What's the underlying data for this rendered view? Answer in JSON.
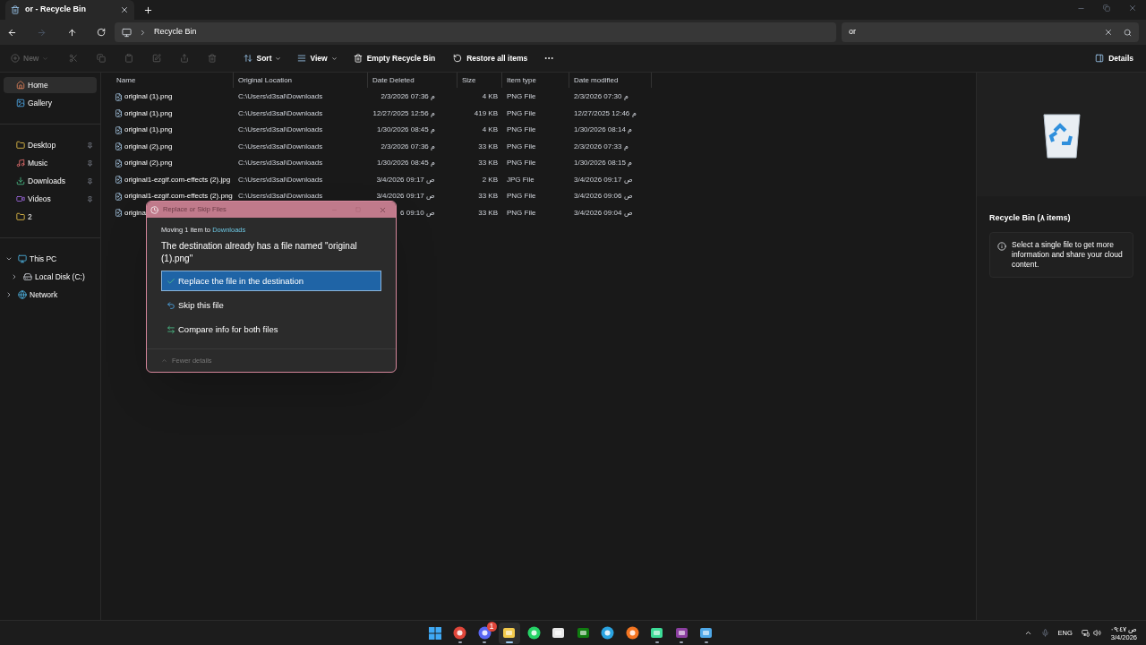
{
  "window": {
    "tab_title": "or - Recycle Bin"
  },
  "address": {
    "location": "Recycle Bin",
    "search_value": "or"
  },
  "toolbar": {
    "items": [
      {
        "kind": "menu",
        "label": "New",
        "disabled": true
      },
      {
        "kind": "icon",
        "disabled": true
      },
      {
        "kind": "icon",
        "disabled": true
      },
      {
        "kind": "icon",
        "disabled": true
      },
      {
        "kind": "icon",
        "disabled": true
      },
      {
        "kind": "icon",
        "disabled": true
      },
      {
        "kind": "icon",
        "disabled": true
      },
      {
        "kind": "menu",
        "label": "Sort",
        "disabled": false
      },
      {
        "kind": "menu",
        "label": "View",
        "disabled": false
      },
      {
        "kind": "action",
        "label": "Empty Recycle Bin",
        "disabled": false
      },
      {
        "kind": "action",
        "label": "Restore all items",
        "disabled": false
      },
      {
        "kind": "more",
        "disabled": false
      }
    ],
    "details_label": "Details"
  },
  "sidebar": {
    "groups": [
      [
        {
          "label": "Home",
          "selected": true,
          "pinned": false
        },
        {
          "label": "Gallery",
          "selected": false,
          "pinned": false
        }
      ],
      [
        {
          "label": "Desktop",
          "selected": false,
          "pinned": true
        },
        {
          "label": "Music",
          "selected": false,
          "pinned": true
        },
        {
          "label": "Downloads",
          "selected": false,
          "pinned": true
        },
        {
          "label": "Videos",
          "selected": false,
          "pinned": true
        },
        {
          "label": "2",
          "selected": false,
          "pinned": false
        }
      ],
      [
        {
          "label": "This PC",
          "selected": false,
          "pinned": false,
          "expanded": true,
          "children": [
            {
              "label": "Local Disk (C:)",
              "selected": false,
              "pinned": false,
              "expanded": false
            }
          ]
        },
        {
          "label": "Network",
          "selected": false,
          "pinned": false,
          "expanded": false
        }
      ]
    ]
  },
  "table": {
    "columns": [
      "Name",
      "Original Location",
      "Date Deleted",
      "Size",
      "Item type",
      "Date modified"
    ],
    "rows": [
      {
        "name": "original (1).png",
        "location": "C:\\Users\\d3sal\\Downloads",
        "date_deleted": "2/3/2026 07:36 م",
        "size": "4 KB",
        "type": "PNG File",
        "modified": "2/3/2026 07:30 م"
      },
      {
        "name": "original (1).png",
        "location": "C:\\Users\\d3sal\\Downloads",
        "date_deleted": "12/27/2025 12:56 م",
        "size": "419 KB",
        "type": "PNG File",
        "modified": "12/27/2025 12:46 م"
      },
      {
        "name": "original (1).png",
        "location": "C:\\Users\\d3sal\\Downloads",
        "date_deleted": "1/30/2026 08:45 م",
        "size": "4 KB",
        "type": "PNG File",
        "modified": "1/30/2026 08:14 م"
      },
      {
        "name": "original (2).png",
        "location": "C:\\Users\\d3sal\\Downloads",
        "date_deleted": "2/3/2026 07:36 م",
        "size": "33 KB",
        "type": "PNG File",
        "modified": "2/3/2026 07:33 م"
      },
      {
        "name": "original (2).png",
        "location": "C:\\Users\\d3sal\\Downloads",
        "date_deleted": "1/30/2026 08:45 م",
        "size": "33 KB",
        "type": "PNG File",
        "modified": "1/30/2026 08:15 م"
      },
      {
        "name": "original1-ezgif.com-effects (2).jpg",
        "location": "C:\\Users\\d3sal\\Downloads",
        "date_deleted": "3/4/2026 09:17 ص",
        "size": "2 KB",
        "type": "JPG File",
        "modified": "3/4/2026 09:17 ص"
      },
      {
        "name": "original1-ezgif.com-effects (2).png",
        "location": "C:\\Users\\d3sal\\Downloads",
        "date_deleted": "3/4/2026 09:17 ص",
        "size": "33 KB",
        "type": "PNG File",
        "modified": "3/4/2026 09:06 ص"
      },
      {
        "name": "origina",
        "date_deleted": "6 09:10 ص",
        "size": "33 KB",
        "type": "PNG File",
        "modified": "3/4/2026 09:04 ص"
      }
    ]
  },
  "details_pane": {
    "title": "Recycle Bin (٨ items)",
    "info": "Select a single file to get more information and share your cloud content."
  },
  "dialog": {
    "title": "Replace or Skip Files",
    "moving_prefix": "Moving 1 item to",
    "moving_target": "Downloads",
    "message": "The destination already has a file named \"original (1).png\"",
    "options": [
      {
        "label": "Replace the file in the destination",
        "selected": true
      },
      {
        "label": "Skip this file",
        "selected": false
      },
      {
        "label": "Compare info for both files",
        "selected": false
      }
    ],
    "footer": "Fewer details"
  },
  "taskbar": {
    "apps": [
      {
        "selected": false,
        "running": false
      },
      {
        "selected": false,
        "running": true
      },
      {
        "selected": false,
        "running": true,
        "badge": "1"
      },
      {
        "selected": true,
        "running": true
      },
      {
        "selected": false,
        "running": false
      },
      {
        "selected": false,
        "running": false
      },
      {
        "selected": false,
        "running": false
      },
      {
        "selected": false,
        "running": false
      },
      {
        "selected": false,
        "running": false
      },
      {
        "selected": false,
        "running": true
      },
      {
        "selected": false,
        "running": true
      },
      {
        "selected": false,
        "running": true
      }
    ],
    "language": "ENG",
    "time": "ص ٠٩:٤٧",
    "date": "3/4/2026"
  }
}
